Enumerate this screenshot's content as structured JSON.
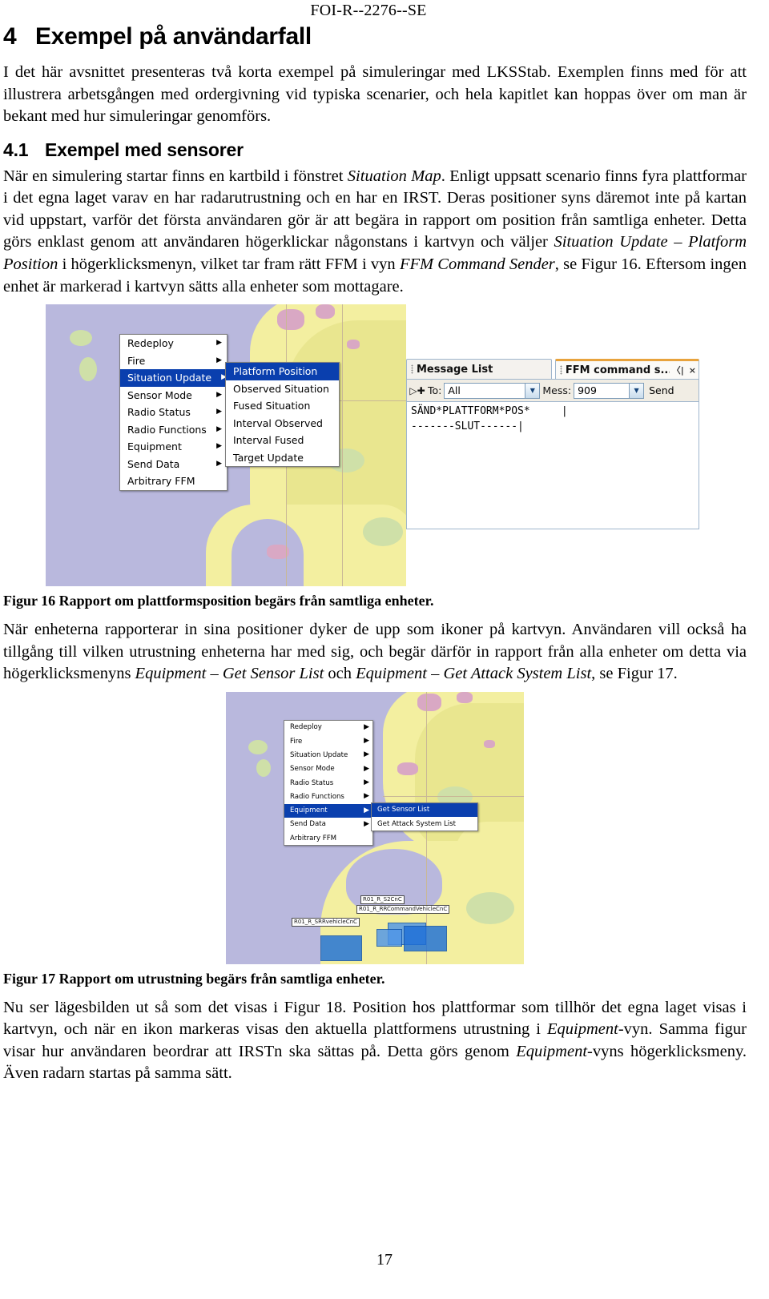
{
  "document": {
    "header": "FOI-R--2276--SE",
    "page_number": "17"
  },
  "chapter": {
    "number": "4",
    "title": "Exempel på användarfall"
  },
  "intro_paragraph": "I det här avsnittet presenteras två korta exempel på simuleringar med LKSStab. Exemplen finns med för att illustrera arbetsgången med ordergivning vid typiska scenarier, och hela kapitlet kan hoppas över om man är bekant med hur simuleringar genomförs.",
  "section": {
    "number": "4.1",
    "title": "Exempel med sensorer"
  },
  "paragraph_1": {
    "part1": "När en simulering startar finns en kartbild i fönstret ",
    "italic1": "Situation Map",
    "part2": ". Enligt uppsatt scenario finns fyra plattformar i det egna laget varav en har radarutrustning och en har en IRST. Deras positioner syns däremot inte på kartan vid uppstart, varför det första användaren gör är att begära in rapport om position från samtliga enheter. Detta görs enklast genom att användaren högerklickar någonstans i kartvyn och väljer ",
    "italic2": "Situation Update – Platform Position",
    "part3": " i högerklicksmenyn, vilket tar fram rätt FFM i vyn ",
    "italic3": "FFM Command Sender",
    "part4": ", se Figur 16. Eftersom ingen enhet är markerad i kartvyn sätts alla enheter som mottagare."
  },
  "figure16": {
    "caption": "Figur 16 Rapport om plattformsposition begärs från samtliga enheter.",
    "context_menu": {
      "items": [
        {
          "label": "Redeploy",
          "submenu": true,
          "selected": false
        },
        {
          "label": "Fire",
          "submenu": true,
          "selected": false
        },
        {
          "label": "Situation Update",
          "submenu": true,
          "selected": true
        },
        {
          "label": "Sensor Mode",
          "submenu": true,
          "selected": false
        },
        {
          "label": "Radio Status",
          "submenu": true,
          "selected": false
        },
        {
          "label": "Radio Functions",
          "submenu": true,
          "selected": false
        },
        {
          "label": "Equipment",
          "submenu": true,
          "selected": false
        },
        {
          "label": "Send Data",
          "submenu": true,
          "selected": false
        },
        {
          "label": "Arbitrary FFM",
          "submenu": false,
          "selected": false
        }
      ]
    },
    "submenu": {
      "items": [
        {
          "label": "Platform Position",
          "selected": true
        },
        {
          "label": "Observed Situation",
          "selected": false
        },
        {
          "label": "Fused Situation",
          "selected": false
        },
        {
          "label": "Interval Observed",
          "selected": false
        },
        {
          "label": "Interval Fused",
          "selected": false
        },
        {
          "label": "Target Update",
          "selected": false
        }
      ]
    },
    "panel": {
      "tab_message_list": "Message List",
      "tab_ffm": "FFM command s...",
      "tab_ffm_speaker_icon": "speaker-icon",
      "tab_ffm_close_icon": "×",
      "move_icon": "move-cursor-icon",
      "to_label": "To:",
      "to_value": "All",
      "mess_label": "Mess:",
      "mess_value": "909",
      "send_label": "Send",
      "message_body_line1": "SÄND*PLATTFORM*POS*     |",
      "message_body_line2": "-------SLUT------|"
    }
  },
  "paragraph_2": {
    "part1": "När enheterna rapporterar in sina positioner dyker de upp som ikoner på kartvyn. Användaren vill också ha tillgång till vilken utrustning enheterna har med sig, och begär därför in rapport från alla enheter om detta via högerklicksmenyns ",
    "italic1": "Equipment – Get Sensor List",
    "part2": " och ",
    "italic2": "Equipment – Get Attack System List",
    "part3": ", se Figur 17."
  },
  "figure17": {
    "caption": "Figur 17 Rapport om utrustning begärs från samtliga enheter.",
    "context_menu": {
      "items": [
        {
          "label": "Redeploy",
          "submenu": true,
          "selected": false
        },
        {
          "label": "Fire",
          "submenu": true,
          "selected": false
        },
        {
          "label": "Situation Update",
          "submenu": true,
          "selected": false
        },
        {
          "label": "Sensor Mode",
          "submenu": true,
          "selected": false
        },
        {
          "label": "Radio Status",
          "submenu": true,
          "selected": false
        },
        {
          "label": "Radio Functions",
          "submenu": true,
          "selected": false
        },
        {
          "label": "Equipment",
          "submenu": true,
          "selected": true
        },
        {
          "label": "Send Data",
          "submenu": true,
          "selected": false
        },
        {
          "label": "Arbitrary FFM",
          "submenu": false,
          "selected": false
        }
      ]
    },
    "submenu": {
      "items": [
        {
          "label": "Get Sensor List",
          "selected": true
        },
        {
          "label": "Get Attack System List",
          "selected": false
        }
      ]
    },
    "map_labels": [
      {
        "text": "R01_R_S2CnC"
      },
      {
        "text": "R01_R_RRCommandVehicleCnC"
      },
      {
        "text": "R01_R_SRRvehicleCnC"
      }
    ]
  },
  "paragraph_3": {
    "part1": "Nu ser lägesbilden ut så som det visas i Figur 18. Position hos plattformar som tillhör det egna laget visas i kartvyn, och när en ikon markeras visas den aktuella plattformens utrustning i ",
    "italic1": "Equipment",
    "part2": "-vyn. Samma figur visar hur användaren beordrar att IRSTn ska sättas på. Detta görs genom ",
    "italic2": "Equipment",
    "part3": "-vyns högerklicksmeny. Även radarn startas på samma sätt."
  },
  "colors": {
    "menu_selected": "#0a3fae",
    "map_water": "#b9b8dd",
    "map_land": "#f3efa0",
    "tab_accent": "#e8a33d"
  }
}
